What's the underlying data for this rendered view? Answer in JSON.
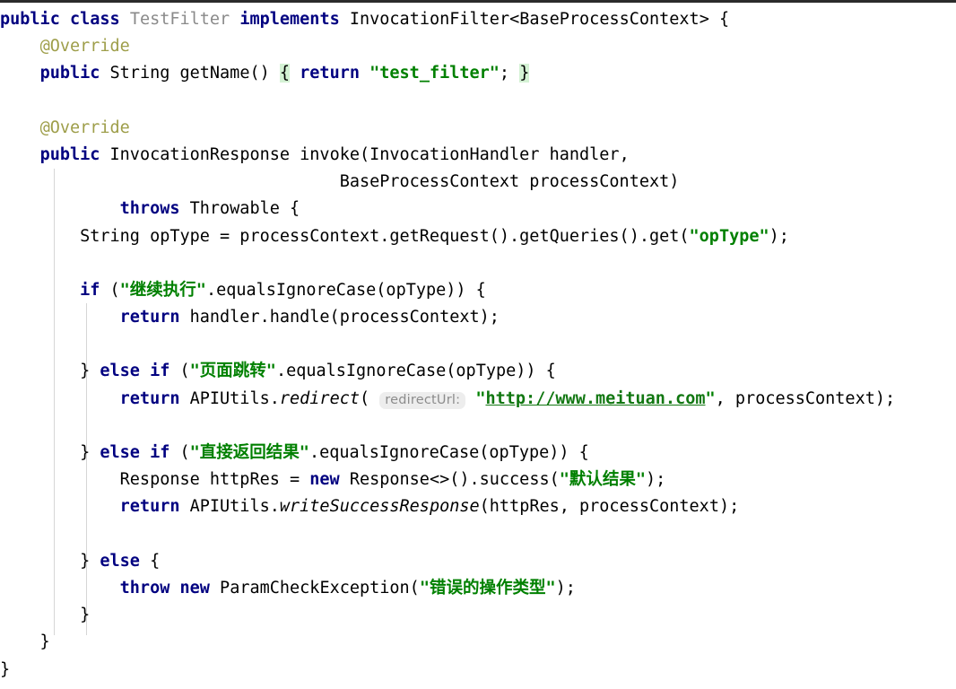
{
  "editor": {
    "language": "Java",
    "background": "#ffffff",
    "font_size_px": 18.5,
    "colors": {
      "keyword": "#000080",
      "string": "#008000",
      "annotation": "#9e9e4a",
      "class_name": "#8a8a8a",
      "link": "#117711",
      "brace_highlight": "#d4f2d4",
      "hint_background": "#ededed",
      "hint_text": "#8c8c8c",
      "indent_guide": "#d6d6d6",
      "default_text": "#000000"
    }
  },
  "code": {
    "lines": [
      {
        "n": 1,
        "text": "public class TestFilter implements InvocationFilter<BaseProcessContext> {",
        "tokens": [
          {
            "t": "public",
            "k": "kw"
          },
          {
            "t": " ",
            "k": "plain"
          },
          {
            "t": "class",
            "k": "kw"
          },
          {
            "t": " ",
            "k": "plain"
          },
          {
            "t": "TestFilter",
            "k": "cls"
          },
          {
            "t": " ",
            "k": "plain"
          },
          {
            "t": "implements",
            "k": "kw"
          },
          {
            "t": " InvocationFilter<BaseProcessContext> {",
            "k": "plain"
          }
        ]
      },
      {
        "n": 2,
        "text": "    @Override",
        "tokens": [
          {
            "t": "    ",
            "k": "plain"
          },
          {
            "t": "@Override",
            "k": "anno"
          }
        ]
      },
      {
        "n": 3,
        "text": "    public String getName() { return \"test_filter\"; }",
        "tokens": [
          {
            "t": "    ",
            "k": "plain"
          },
          {
            "t": "public",
            "k": "kw"
          },
          {
            "t": " String getName() ",
            "k": "plain"
          },
          {
            "t": "{",
            "k": "brace-open"
          },
          {
            "t": " ",
            "k": "plain"
          },
          {
            "t": "return",
            "k": "kw"
          },
          {
            "t": " ",
            "k": "plain"
          },
          {
            "t": "\"test_filter\"",
            "k": "str"
          },
          {
            "t": "; ",
            "k": "plain"
          },
          {
            "t": "}",
            "k": "brace-close"
          }
        ]
      },
      {
        "n": 4,
        "text": "",
        "tokens": []
      },
      {
        "n": 5,
        "text": "    @Override",
        "tokens": [
          {
            "t": "    ",
            "k": "plain"
          },
          {
            "t": "@Override",
            "k": "anno"
          }
        ]
      },
      {
        "n": 6,
        "text": "    public InvocationResponse invoke(InvocationHandler handler,",
        "tokens": [
          {
            "t": "    ",
            "k": "plain"
          },
          {
            "t": "public",
            "k": "kw"
          },
          {
            "t": " InvocationResponse invoke(InvocationHandler handler,",
            "k": "plain"
          }
        ]
      },
      {
        "n": 7,
        "text": "                                  BaseProcessContext processContext)",
        "tokens": [
          {
            "t": "                                  BaseProcessContext processContext)",
            "k": "plain"
          }
        ]
      },
      {
        "n": 8,
        "text": "            throws Throwable {",
        "tokens": [
          {
            "t": "            ",
            "k": "plain"
          },
          {
            "t": "throws",
            "k": "kw"
          },
          {
            "t": " Throwable {",
            "k": "plain"
          }
        ]
      },
      {
        "n": 9,
        "text": "        String opType = processContext.getRequest().getQueries().get(\"opType\");",
        "tokens": [
          {
            "t": "        String opType = processContext.getRequest().getQueries().get(",
            "k": "plain"
          },
          {
            "t": "\"opType\"",
            "k": "str"
          },
          {
            "t": ");",
            "k": "plain"
          }
        ]
      },
      {
        "n": 10,
        "text": "",
        "tokens": []
      },
      {
        "n": 11,
        "text": "        if (\"继续执行\".equalsIgnoreCase(opType)) {",
        "tokens": [
          {
            "t": "        ",
            "k": "plain"
          },
          {
            "t": "if",
            "k": "kw"
          },
          {
            "t": " (",
            "k": "plain"
          },
          {
            "t": "\"继续执行\"",
            "k": "str"
          },
          {
            "t": ".equalsIgnoreCase(opType)) {",
            "k": "plain"
          }
        ]
      },
      {
        "n": 12,
        "text": "            return handler.handle(processContext);",
        "tokens": [
          {
            "t": "            ",
            "k": "plain"
          },
          {
            "t": "return",
            "k": "kw"
          },
          {
            "t": " handler.handle(processContext);",
            "k": "plain"
          }
        ]
      },
      {
        "n": 13,
        "text": "",
        "tokens": []
      },
      {
        "n": 14,
        "text": "        } else if (\"页面跳转\".equalsIgnoreCase(opType)) {",
        "tokens": [
          {
            "t": "        } ",
            "k": "plain"
          },
          {
            "t": "else",
            "k": "kw"
          },
          {
            "t": " ",
            "k": "plain"
          },
          {
            "t": "if",
            "k": "kw"
          },
          {
            "t": " (",
            "k": "plain"
          },
          {
            "t": "\"页面跳转\"",
            "k": "str"
          },
          {
            "t": ".equalsIgnoreCase(opType)) {",
            "k": "plain"
          }
        ]
      },
      {
        "n": 15,
        "text": "            return APIUtils.redirect( redirectUrl: \"http://www.meituan.com\", processContext);",
        "hint": "redirectUrl:",
        "url": "http://www.meituan.com",
        "tokens": [
          {
            "t": "            ",
            "k": "plain"
          },
          {
            "t": "return",
            "k": "kw"
          },
          {
            "t": " APIUtils.",
            "k": "plain"
          },
          {
            "t": "redirect",
            "k": "ital"
          },
          {
            "t": "( ",
            "k": "plain"
          },
          {
            "t": "redirectUrl:",
            "k": "hint"
          },
          {
            "t": " ",
            "k": "plain"
          },
          {
            "t": "\"",
            "k": "str"
          },
          {
            "t": "http://www.meituan.com",
            "k": "link"
          },
          {
            "t": "\"",
            "k": "str"
          },
          {
            "t": ", processContext);",
            "k": "plain"
          }
        ]
      },
      {
        "n": 16,
        "text": "",
        "tokens": []
      },
      {
        "n": 17,
        "text": "        } else if (\"直接返回结果\".equalsIgnoreCase(opType)) {",
        "tokens": [
          {
            "t": "        } ",
            "k": "plain"
          },
          {
            "t": "else",
            "k": "kw"
          },
          {
            "t": " ",
            "k": "plain"
          },
          {
            "t": "if",
            "k": "kw"
          },
          {
            "t": " (",
            "k": "plain"
          },
          {
            "t": "\"直接返回结果\"",
            "k": "str"
          },
          {
            "t": ".equalsIgnoreCase(opType)) {",
            "k": "plain"
          }
        ]
      },
      {
        "n": 18,
        "text": "            Response httpRes = new Response<>().success(\"默认结果\");",
        "tokens": [
          {
            "t": "            Response httpRes = ",
            "k": "plain"
          },
          {
            "t": "new",
            "k": "kw"
          },
          {
            "t": " Response<>().success(",
            "k": "plain"
          },
          {
            "t": "\"默认结果\"",
            "k": "str"
          },
          {
            "t": ");",
            "k": "plain"
          }
        ]
      },
      {
        "n": 19,
        "text": "            return APIUtils.writeSuccessResponse(httpRes, processContext);",
        "tokens": [
          {
            "t": "            ",
            "k": "plain"
          },
          {
            "t": "return",
            "k": "kw"
          },
          {
            "t": " APIUtils.",
            "k": "plain"
          },
          {
            "t": "writeSuccessResponse",
            "k": "ital"
          },
          {
            "t": "(httpRes, processContext);",
            "k": "plain"
          }
        ]
      },
      {
        "n": 20,
        "text": "",
        "tokens": []
      },
      {
        "n": 21,
        "text": "        } else {",
        "tokens": [
          {
            "t": "        } ",
            "k": "plain"
          },
          {
            "t": "else",
            "k": "kw"
          },
          {
            "t": " {",
            "k": "plain"
          }
        ]
      },
      {
        "n": 22,
        "text": "            throw new ParamCheckException(\"错误的操作类型\");",
        "tokens": [
          {
            "t": "            ",
            "k": "plain"
          },
          {
            "t": "throw",
            "k": "kw"
          },
          {
            "t": " ",
            "k": "plain"
          },
          {
            "t": "new",
            "k": "kw"
          },
          {
            "t": " ParamCheckException(",
            "k": "plain"
          },
          {
            "t": "\"错误的操作类型\"",
            "k": "str"
          },
          {
            "t": ");",
            "k": "plain"
          }
        ]
      },
      {
        "n": 23,
        "text": "        }",
        "tokens": [
          {
            "t": "        }",
            "k": "plain"
          }
        ]
      },
      {
        "n": 24,
        "text": "    }",
        "tokens": [
          {
            "t": "    }",
            "k": "plain"
          }
        ]
      },
      {
        "n": 25,
        "text": "}",
        "tokens": [
          {
            "t": "}",
            "k": "plain"
          }
        ]
      }
    ]
  }
}
